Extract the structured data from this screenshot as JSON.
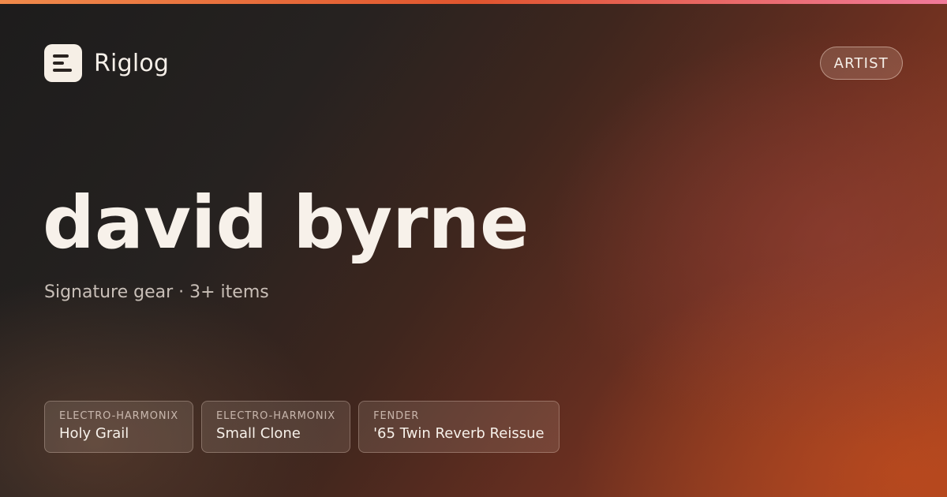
{
  "brand": {
    "name": "Riglog",
    "logo_icon": "riglog-logo-icon"
  },
  "badge": {
    "label": "ARTIST"
  },
  "artist": {
    "name": "david byrne",
    "subtitle": "Signature gear · 3+ items"
  },
  "gear": [
    {
      "brand": "ELECTRO-HARMONIX",
      "name": "Holy Grail"
    },
    {
      "brand": "ELECTRO-HARMONIX",
      "name": "Small Clone"
    },
    {
      "brand": "FENDER",
      "name": "'65 Twin Reverb Reissue"
    }
  ],
  "colors": {
    "accent_orange": "#f08a4b",
    "accent_pink": "#f07a9a",
    "text_light": "#f5efe8",
    "bg_dark": "#1d1c1c",
    "bg_rust": "#a8431f"
  }
}
